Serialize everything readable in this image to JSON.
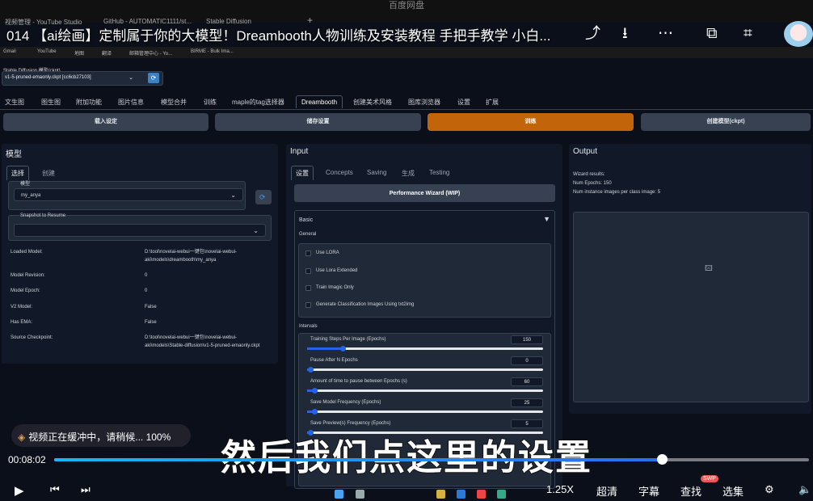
{
  "browser": {
    "window_title": "百度网盘",
    "tabs": [
      "视频管理 - YouTube Studio",
      "GitHub - AUTOMATIC1111/st...",
      "Stable Diffusion"
    ],
    "bookmarks": [
      "Gmail",
      "YouTube",
      "地图",
      "翻译",
      "邮箱管理中心 - Yo...",
      "BIRME - Bulk Ima..."
    ]
  },
  "video": {
    "title": "014 【ai绘画】定制属于你的大模型！Dreambooth人物训练及安装教程 手把手教学 小白...",
    "top_icons": [
      "share-icon",
      "download-icon",
      "more-icon",
      "pip-icon",
      "crop-icon"
    ],
    "buffering_text": "视频正在缓冲中，请稍候... 100%",
    "subtitle": "然后我们点这里的设置",
    "current_time": "00:08:02",
    "progress": 0.805,
    "speed": "1.25X",
    "quality": "超清",
    "captions": "字幕",
    "search": "查找",
    "episodes": "选集",
    "swp_badge": "SWP"
  },
  "webui": {
    "ckpt_label": "Stable Diffusion 模型(ckpt)",
    "ckpt_value": "v1-5-pruned-emaonly.ckpt [cc6cb27103]",
    "tabs": [
      "文生图",
      "图生图",
      "附加功能",
      "图片信息",
      "模型合并",
      "训练",
      "maple的tag选择器",
      "Dreambooth",
      "创建美术风格",
      "图库浏览器",
      "设置",
      "扩展"
    ],
    "active_tab": "Dreambooth",
    "buttons": {
      "load": "载入设定",
      "save": "储存设置",
      "train": "训练",
      "create": "创建模型(ckpt)"
    },
    "model_panel": {
      "title": "模型",
      "subtabs": [
        "选择",
        "创建"
      ],
      "model_label": "模型",
      "model_value": "my_anya",
      "snapshot_label": "Snapshot to Resume",
      "info": [
        {
          "label": "Loaded Model:",
          "value": "D:\\tool\\novelai-webui一键包\\novelai-webui-aki\\models\\dreambooth\\my_anya"
        },
        {
          "label": "Model Revision:",
          "value": "0"
        },
        {
          "label": "Model Epoch:",
          "value": "0"
        },
        {
          "label": "V2 Model:",
          "value": "False"
        },
        {
          "label": "Has EMA:",
          "value": "False"
        },
        {
          "label": "Source Checkpoint:",
          "value": "D:\\tool\\novelai-webui一键包\\novelai-webui-aki\\models\\Stable-diffusion\\v1-5-pruned-emaonly.ckpt"
        }
      ]
    },
    "input_panel": {
      "title": "Input",
      "subtabs": [
        "设置",
        "Concepts",
        "Saving",
        "生成",
        "Testing"
      ],
      "wizard": "Performance Wizard (WIP)",
      "basic": "Basic",
      "general": "General",
      "checkboxes": [
        "Use LORA",
        "Use Lora Extended",
        "Train Imagic Only",
        "Generate Classification Images Using txt2img"
      ],
      "intervals": "Intervals",
      "sliders": [
        {
          "label": "Training Steps Per Image (Epochs)",
          "value": 150,
          "fraction": 0.15
        },
        {
          "label": "Pause After N Epochs",
          "value": 0,
          "fraction": 0
        },
        {
          "label": "Amount of time to pause between Epochs (s)",
          "value": 60,
          "fraction": 0.03
        },
        {
          "label": "Save Model Frequency (Epochs)",
          "value": 25,
          "fraction": 0.03
        },
        {
          "label": "Save Preview(s) Frequency (Epochs)",
          "value": 5,
          "fraction": 0.01
        }
      ]
    },
    "output_panel": {
      "title": "Output",
      "results_title": "Wizard results:",
      "results": [
        "Num Epochs: 150",
        "Num instance images per class image: 5"
      ]
    }
  }
}
